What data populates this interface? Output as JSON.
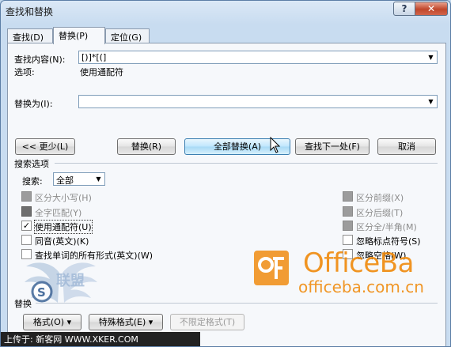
{
  "window": {
    "title": "查找和替换",
    "help_label": "?",
    "close_label": "✕"
  },
  "tabs": [
    {
      "label": "查找(D)"
    },
    {
      "label": "替换(P)"
    },
    {
      "label": "定位(G)"
    }
  ],
  "find": {
    "label": "查找内容(N):",
    "value": "[)]*[(]"
  },
  "options": {
    "label": "选项:",
    "value": "使用通配符"
  },
  "replace": {
    "label": "替换为(I):",
    "value": ""
  },
  "buttons": {
    "less": "<< 更少(L)",
    "replace": "替换(R)",
    "replace_all": "全部替换(A)",
    "find_next": "查找下一处(F)",
    "cancel": "取消"
  },
  "search_options": {
    "title": "搜索选项",
    "search_label": "搜索:",
    "search_value": "全部",
    "left": [
      {
        "label": "区分大小写(H)",
        "state": "disabled"
      },
      {
        "label": "全字匹配(Y)",
        "state": "indeterminate"
      },
      {
        "label": "使用通配符(U)",
        "state": "checked"
      },
      {
        "label": "同音(英文)(K)",
        "state": "unchecked"
      },
      {
        "label": "查找单词的所有形式(英文)(W)",
        "state": "unchecked"
      }
    ],
    "right": [
      {
        "label": "区分前缀(X)",
        "state": "disabled"
      },
      {
        "label": "区分后缀(T)",
        "state": "disabled"
      },
      {
        "label": "区分全/半角(M)",
        "state": "disabled"
      },
      {
        "label": "忽略标点符号(S)",
        "state": "unchecked"
      },
      {
        "label": "忽略空格(W)",
        "state": "unchecked"
      }
    ]
  },
  "replace_section": {
    "title": "替换",
    "format": "格式(O) ▾",
    "special": "特殊格式(E) ▾",
    "no_format": "不限定格式(T)"
  },
  "watermark": {
    "brand": "OfficeBa",
    "url": "officeba.com.cn",
    "left_text": "联盟",
    "uploader": "上传于: 新客网 WWW.XKER.COM"
  },
  "colors": {
    "brand_orange": "#f08c10",
    "title_bar": "#c8dcf0",
    "close_red": "#c0472b"
  }
}
